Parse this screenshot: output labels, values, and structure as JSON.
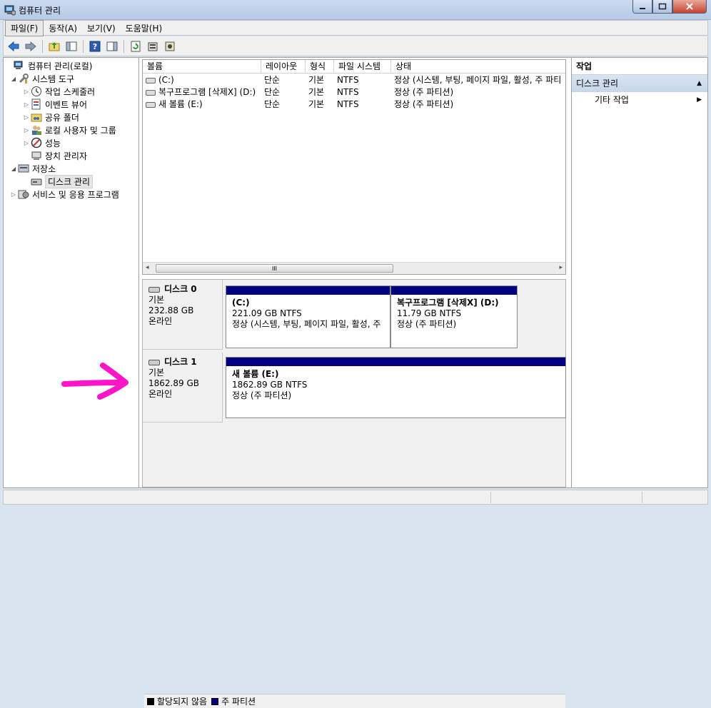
{
  "window": {
    "title": "컴퓨터 관리"
  },
  "menu": {
    "items": [
      "파일(F)",
      "동작(A)",
      "보기(V)",
      "도움말(H)"
    ]
  },
  "toolbar": {
    "icons": [
      "back-arrow-icon",
      "forward-arrow-icon",
      "up-folder-icon",
      "show-hide-tree-icon",
      "help-icon",
      "show-hide-action-icon",
      "refresh-icon",
      "properties-icon",
      "help-topic-icon"
    ]
  },
  "tree": {
    "root": "컴퓨터 관리(로컬)",
    "system_tools": "시스템 도구",
    "task_scheduler": "작업 스케줄러",
    "event_viewer": "이벤트 뷰어",
    "shared_folders": "공유 폴더",
    "local_users": "로컬 사용자 및 그룹",
    "performance": "성능",
    "device_manager": "장치 관리자",
    "storage": "저장소",
    "disk_management": "디스크 관리",
    "services": "서비스 및 응용 프로그램"
  },
  "volume_table": {
    "headers": {
      "volume": "볼륨",
      "layout": "레이아웃",
      "type": "형식",
      "fs": "파일 시스템",
      "status": "상태"
    },
    "rows": [
      {
        "volume": "(C:)",
        "layout": "단순",
        "type": "기본",
        "fs": "NTFS",
        "status": "정상 (시스템, 부팅, 페이지 파일, 활성, 주 파티"
      },
      {
        "volume": "복구프로그램 [삭제X] (D:)",
        "layout": "단순",
        "type": "기본",
        "fs": "NTFS",
        "status": "정상 (주 파티션)"
      },
      {
        "volume": "새 볼륨 (E:)",
        "layout": "단순",
        "type": "기본",
        "fs": "NTFS",
        "status": "정상 (주 파티션)"
      }
    ],
    "scroll_thumb": "III"
  },
  "disks": [
    {
      "name": "디스크 0",
      "kind": "기본",
      "size": "232.88 GB",
      "state": "온라인",
      "partitions": [
        {
          "name": "(C:)",
          "size": "221.09 GB NTFS",
          "status": "정상 (시스템, 부팅, 페이지 파일, 활성, 주"
        },
        {
          "name": "복구프로그램 [삭제X]  (D:)",
          "size": "11.79 GB NTFS",
          "status": "정상 (주 파티션)"
        }
      ]
    },
    {
      "name": "디스크 1",
      "kind": "기본",
      "size": "1862.89 GB",
      "state": "온라인",
      "partitions": [
        {
          "name": "새 볼륨  (E:)",
          "size": "1862.89 GB NTFS",
          "status": "정상 (주 파티션)"
        }
      ]
    }
  ],
  "legend": {
    "unallocated": "할당되지 않음",
    "primary": "주 파티션",
    "unallocated_color": "#000000",
    "primary_color": "#000080"
  },
  "actions": {
    "header": "작업",
    "section": "디스크 관리",
    "more": "기타 작업"
  },
  "colors": {
    "partition_bar": "#000080",
    "annotation_arrow": "#ff14c8"
  }
}
